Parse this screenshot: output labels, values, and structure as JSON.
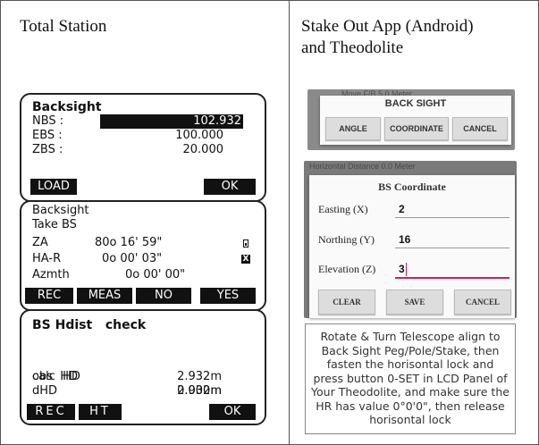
{
  "left_heading": "Total Station",
  "right_heading_line1": "Stake Out App (Android)",
  "right_heading_line2": "and Theodolite",
  "backsight_screen": {
    "title": "Backsight",
    "rows": [
      {
        "label": "NBS :",
        "value": "102.932"
      },
      {
        "label": "EBS :",
        "value": "100.000"
      },
      {
        "label": "ZBS :",
        "value": "20.000"
      }
    ],
    "softkeys": {
      "load": "LOAD",
      "ok": "OK"
    }
  },
  "take_bs_screen": {
    "title": "Backsight",
    "subtitle": "Take  BS",
    "rows": [
      {
        "label": "ZA",
        "value": "80o 16' 59\""
      },
      {
        "label": "HA-R",
        "value": "0o 00' 03\""
      },
      {
        "label": "Azmth",
        "value": "0o  00' 00\""
      }
    ],
    "battery_icon": "battery-icon",
    "x_icon_glyph": "X",
    "softkeys": {
      "rec": "REC",
      "meas": "MEAS",
      "no": "NO",
      "yes": "YES"
    }
  },
  "bs_check_screen": {
    "title": "BS Hdist   check",
    "rows": [
      {
        "label": "calc  HD",
        "value": "2.932m"
      },
      {
        "label": "obs  HD",
        "value": "2.932m"
      },
      {
        "label": "dHD",
        "value": "0.000m"
      }
    ],
    "softkeys": {
      "rec": "REC",
      "ht": "HT",
      "ok": "OK"
    }
  },
  "back_sight_dialog": {
    "ghost_text_top": "Move F/B      5.0 Meter",
    "title": "BACK SIGHT",
    "buttons": {
      "angle": "ANGLE",
      "coordinate": "COORDINATE",
      "cancel": "CANCEL"
    },
    "ghost_text_bottom": "Horizontal Distance      0.0 Meter"
  },
  "bs_coordinate_dialog": {
    "title": "BS Coordinate",
    "fields": [
      {
        "label": "Easting (X)",
        "value": "2"
      },
      {
        "label": "Northing (Y)",
        "value": "16"
      },
      {
        "label": "Elevation (Z)",
        "value": "3"
      }
    ],
    "buttons": {
      "clear": "CLEAR",
      "save": "SAVE",
      "cancel": "CANCEL"
    }
  },
  "instruction_note": "Rotate & Turn Telescope align to Back Sight Peg/Pole/Stake, then fasten the horisontal lock and press button 0-SET in LCD Panel of Your Theodolite, and make sure the HR has value 0°0'0\", then release horisontal lock",
  "colors": {
    "accent": "#d81b60",
    "lcd_bg": "#ffffff",
    "lcd_fg": "#111111"
  }
}
